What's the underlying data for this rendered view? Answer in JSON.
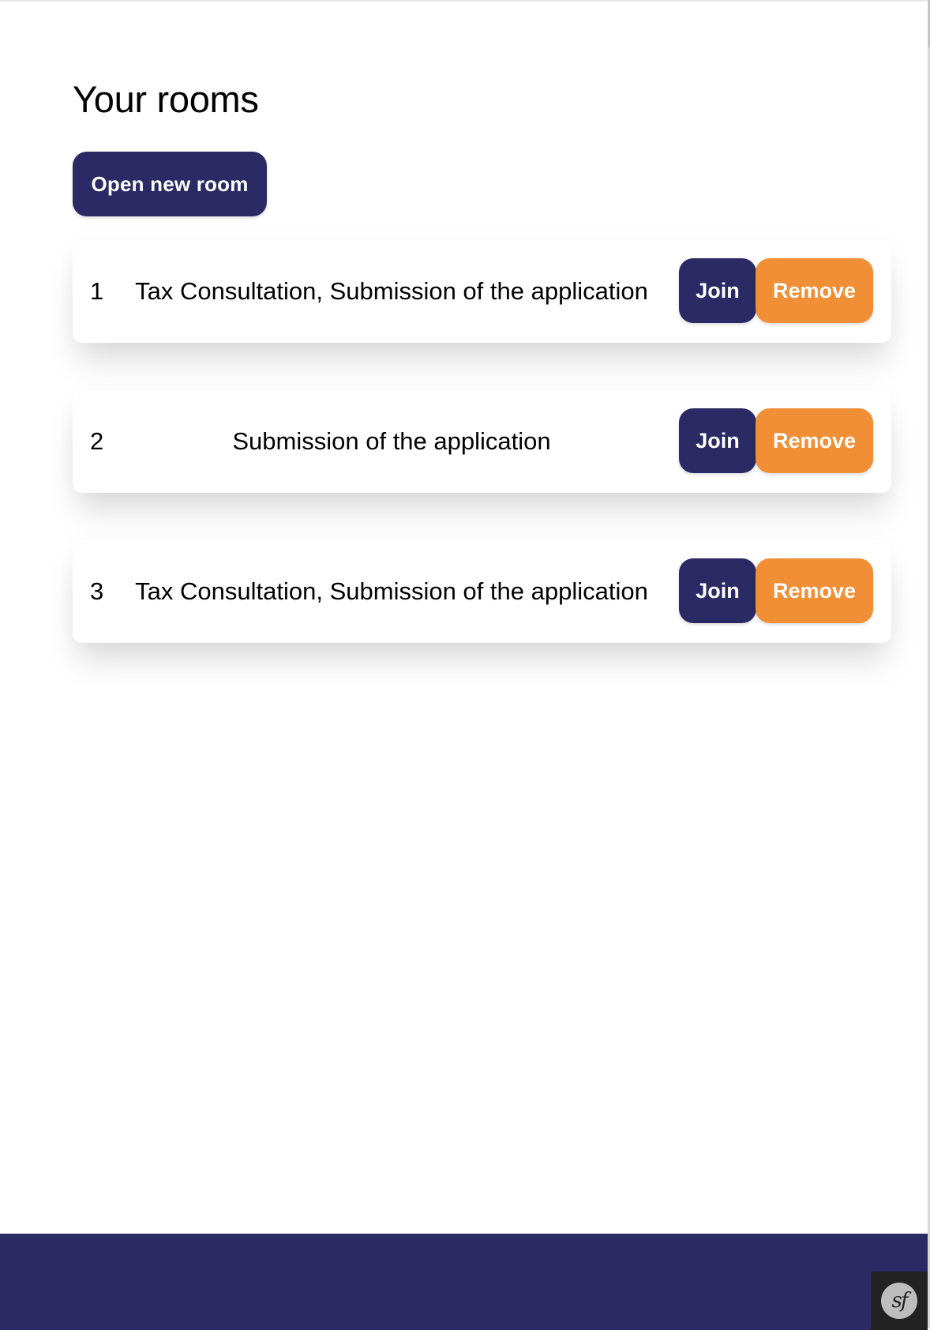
{
  "page": {
    "title": "Your rooms",
    "open_new_room_label": "Open new room"
  },
  "rooms": [
    {
      "index": "1",
      "name": "Tax Consultation, Submission of the application",
      "join_label": "Join",
      "remove_label": "Remove"
    },
    {
      "index": "2",
      "name": "Submission of the application",
      "join_label": "Join",
      "remove_label": "Remove"
    },
    {
      "index": "3",
      "name": "Tax Consultation, Submission of the application",
      "join_label": "Join",
      "remove_label": "Remove"
    }
  ],
  "toolbar": {
    "icon": "symfony-logo-icon",
    "logo_text": "sf"
  },
  "colors": {
    "primary": "#2c2a64",
    "danger": "#f08f36",
    "toolbar": "#222222"
  }
}
